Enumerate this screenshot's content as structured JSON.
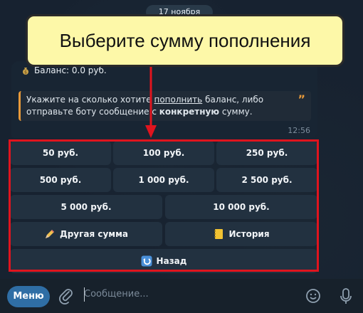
{
  "header": {
    "date": "17 ноября"
  },
  "message": {
    "balance": "Баланс: 0.0 руб.",
    "quote_line1_pre": "Укажите на сколько хотите ",
    "quote_link": "пополнить",
    "quote_line1_post": " баланс, либо",
    "quote_line2_pre": "отправьте боту сообщение с ",
    "quote_bold": "конкретную",
    "quote_line2_post": " сумму.",
    "time": "12:56"
  },
  "keyboard": {
    "b50": "50 руб.",
    "b100": "100 руб.",
    "b250": "250 руб.",
    "b500": "500 руб.",
    "b1000": "1 000 руб.",
    "b2500": "2 500 руб.",
    "b5000": "5 000 руб.",
    "b10000": "10 000 руб.",
    "other": "Другая сумма",
    "history": "История",
    "back": "Назад"
  },
  "annotation": {
    "callout": "Выберите сумму пополнения",
    "highlight_color": "#e0141e"
  },
  "composer": {
    "menu": "Меню",
    "placeholder": "Сообщение..."
  },
  "icons": [
    "money-bag-icon",
    "quote-icon",
    "pencil-icon",
    "notebook-icon",
    "back-arrow-icon",
    "paperclip-icon",
    "emoji-icon",
    "microphone-icon"
  ]
}
